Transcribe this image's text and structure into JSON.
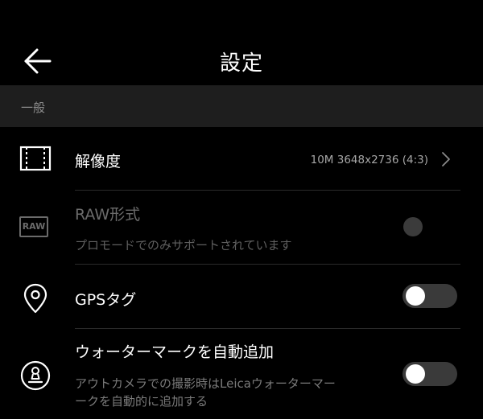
{
  "header": {
    "title": "設定",
    "back_icon": "arrow-left-icon"
  },
  "section": {
    "label": "一般"
  },
  "rows": {
    "resolution": {
      "label": "解像度",
      "value": "10M 3648x2736 (4:3)",
      "icon": "aspect-ratio-icon"
    },
    "raw": {
      "label": "RAW形式",
      "description": "プロモードでのみサポートされています",
      "icon_text": "RAW",
      "enabled": false
    },
    "gps": {
      "label": "GPSタグ",
      "icon": "location-pin-icon",
      "on": false
    },
    "watermark": {
      "label": "ウォーターマークを自動追加",
      "description_line1": "アウトカメラでの撮影時はLeicaウォーターマー",
      "description_line2": "ークを自動的に追加する",
      "icon": "stamp-icon",
      "on": false
    }
  },
  "colors": {
    "background": "#000000",
    "section_bg": "#1e1e1e",
    "toggle_off": "#3a3a3a",
    "dim_text": "#6b6b6b"
  }
}
